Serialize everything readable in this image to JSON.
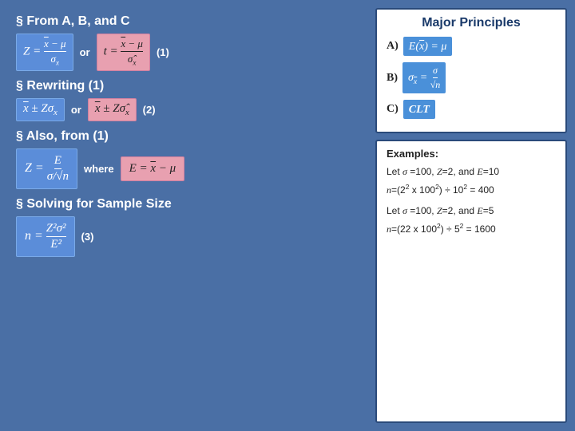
{
  "left": {
    "section1_header": "§ From A, B, and C",
    "or1": "or",
    "label1": "(1)",
    "section2_header": "§ Rewriting (1)",
    "or2": "or",
    "label2": "(2)",
    "section3_header": "§ Also, from (1)",
    "where_label": "where",
    "section4_header": "§ Solving for Sample Size",
    "label3": "(3)"
  },
  "right": {
    "major_principles_title": "Major Principles",
    "principle_a_label": "A)",
    "principle_b_label": "B)",
    "principle_c_label": "C)",
    "principle_c_text": "CLT",
    "examples_title": "Examples:",
    "example1_text": "Let σ =100, Z=2, and E=10",
    "example1_formula": "n=(2² x 100²) ÷ 10² = 400",
    "example2_text": "Let σ =100, Z=2, and E=5",
    "example2_formula": "n=(22 x 1002) ÷ 52 = 1600"
  }
}
